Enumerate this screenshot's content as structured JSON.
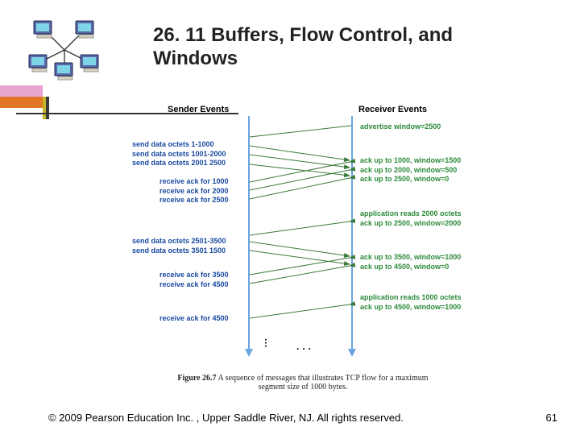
{
  "accent": {
    "pink": "#e7a5cf",
    "orange": "#e07626",
    "yellow": "#c3b52a",
    "dark": "#3a3a3a"
  },
  "title": "26. 11  Buffers, Flow Control, and Windows",
  "headers": {
    "sender": "Sender Events",
    "receiver": "Receiver Events"
  },
  "sender_groups": [
    {
      "class": "send",
      "lines": [
        "send data octets 1-1000",
        "send data octets 1001-2000",
        "send data octets 2001 2500"
      ]
    },
    {
      "class": "send",
      "lines": [
        "receive ack for 1000",
        "receive ack for 2000",
        "receive ack for 2500"
      ]
    },
    {
      "class": "send",
      "lines": [
        "send data octets 2501-3500",
        "send data octets 3501 1500"
      ]
    },
    {
      "class": "send",
      "lines": [
        "receive ack for 3500",
        "receive ack for 4500"
      ]
    },
    {
      "class": "send",
      "lines": [
        "receive ack for 4500"
      ]
    }
  ],
  "receiver_groups": [
    {
      "class": "recv",
      "lines": [
        "advertise window=2500"
      ]
    },
    {
      "class": "recv",
      "lines": [
        "ack up to 1000, window=1500",
        "ack up to 2000, window=500",
        "ack up to 2500, window=0"
      ]
    },
    {
      "class": "recv",
      "lines": [
        "application reads 2000 octets",
        "ack up to 2500, window=2000"
      ]
    },
    {
      "class": "recv",
      "lines": [
        "ack up to 3500, window=1000",
        "ack up to 4500, window=0"
      ]
    },
    {
      "class": "recv",
      "lines": [
        "application reads 1000 octets",
        "ack up to 4500, window=1000"
      ]
    }
  ],
  "caption": {
    "label": "Figure 26.7",
    "text1": " A sequence of messages that illustrates TCP flow for a maximum",
    "text2": "segment size of 1000 bytes."
  },
  "copyright": "© 2009 Pearson Education Inc. , Upper Saddle River, NJ. All rights reserved.",
  "page": "61",
  "chart_data": {
    "type": "sequence",
    "timelines": [
      "Sender",
      "Receiver"
    ],
    "messages": [
      {
        "from": "Receiver",
        "to": "Sender",
        "label": "advertise window=2500"
      },
      {
        "from": "Sender",
        "to": "Receiver",
        "label": "send 1-1000"
      },
      {
        "from": "Sender",
        "to": "Receiver",
        "label": "send 1001-2000"
      },
      {
        "from": "Sender",
        "to": "Receiver",
        "label": "send 2001-2500"
      },
      {
        "from": "Receiver",
        "to": "Sender",
        "label": "ack 1000 win=1500"
      },
      {
        "from": "Receiver",
        "to": "Sender",
        "label": "ack 2000 win=500"
      },
      {
        "from": "Receiver",
        "to": "Sender",
        "label": "ack 2500 win=0"
      },
      {
        "from": "Receiver",
        "to": "Sender",
        "label": "app reads 2000, ack 2500 win=2000"
      },
      {
        "from": "Sender",
        "to": "Receiver",
        "label": "send 2501-3500"
      },
      {
        "from": "Sender",
        "to": "Receiver",
        "label": "send 3501-4500"
      },
      {
        "from": "Receiver",
        "to": "Sender",
        "label": "ack 3500 win=1000"
      },
      {
        "from": "Receiver",
        "to": "Sender",
        "label": "ack 4500 win=0"
      },
      {
        "from": "Receiver",
        "to": "Sender",
        "label": "app reads 1000, ack 4500 win=1000"
      }
    ]
  }
}
